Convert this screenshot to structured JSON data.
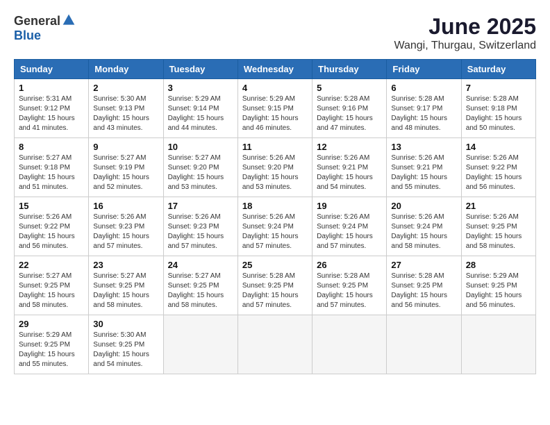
{
  "logo": {
    "general": "General",
    "blue": "Blue"
  },
  "title": {
    "month": "June 2025",
    "location": "Wangi, Thurgau, Switzerland"
  },
  "calendar": {
    "headers": [
      "Sunday",
      "Monday",
      "Tuesday",
      "Wednesday",
      "Thursday",
      "Friday",
      "Saturday"
    ],
    "weeks": [
      [
        {
          "day": "1",
          "sunrise": "5:31 AM",
          "sunset": "9:12 PM",
          "daylight": "15 hours and 41 minutes."
        },
        {
          "day": "2",
          "sunrise": "5:30 AM",
          "sunset": "9:13 PM",
          "daylight": "15 hours and 43 minutes."
        },
        {
          "day": "3",
          "sunrise": "5:29 AM",
          "sunset": "9:14 PM",
          "daylight": "15 hours and 44 minutes."
        },
        {
          "day": "4",
          "sunrise": "5:29 AM",
          "sunset": "9:15 PM",
          "daylight": "15 hours and 46 minutes."
        },
        {
          "day": "5",
          "sunrise": "5:28 AM",
          "sunset": "9:16 PM",
          "daylight": "15 hours and 47 minutes."
        },
        {
          "day": "6",
          "sunrise": "5:28 AM",
          "sunset": "9:17 PM",
          "daylight": "15 hours and 48 minutes."
        },
        {
          "day": "7",
          "sunrise": "5:28 AM",
          "sunset": "9:18 PM",
          "daylight": "15 hours and 50 minutes."
        }
      ],
      [
        {
          "day": "8",
          "sunrise": "5:27 AM",
          "sunset": "9:18 PM",
          "daylight": "15 hours and 51 minutes."
        },
        {
          "day": "9",
          "sunrise": "5:27 AM",
          "sunset": "9:19 PM",
          "daylight": "15 hours and 52 minutes."
        },
        {
          "day": "10",
          "sunrise": "5:27 AM",
          "sunset": "9:20 PM",
          "daylight": "15 hours and 53 minutes."
        },
        {
          "day": "11",
          "sunrise": "5:26 AM",
          "sunset": "9:20 PM",
          "daylight": "15 hours and 53 minutes."
        },
        {
          "day": "12",
          "sunrise": "5:26 AM",
          "sunset": "9:21 PM",
          "daylight": "15 hours and 54 minutes."
        },
        {
          "day": "13",
          "sunrise": "5:26 AM",
          "sunset": "9:21 PM",
          "daylight": "15 hours and 55 minutes."
        },
        {
          "day": "14",
          "sunrise": "5:26 AM",
          "sunset": "9:22 PM",
          "daylight": "15 hours and 56 minutes."
        }
      ],
      [
        {
          "day": "15",
          "sunrise": "5:26 AM",
          "sunset": "9:22 PM",
          "daylight": "15 hours and 56 minutes."
        },
        {
          "day": "16",
          "sunrise": "5:26 AM",
          "sunset": "9:23 PM",
          "daylight": "15 hours and 57 minutes."
        },
        {
          "day": "17",
          "sunrise": "5:26 AM",
          "sunset": "9:23 PM",
          "daylight": "15 hours and 57 minutes."
        },
        {
          "day": "18",
          "sunrise": "5:26 AM",
          "sunset": "9:24 PM",
          "daylight": "15 hours and 57 minutes."
        },
        {
          "day": "19",
          "sunrise": "5:26 AM",
          "sunset": "9:24 PM",
          "daylight": "15 hours and 57 minutes."
        },
        {
          "day": "20",
          "sunrise": "5:26 AM",
          "sunset": "9:24 PM",
          "daylight": "15 hours and 58 minutes."
        },
        {
          "day": "21",
          "sunrise": "5:26 AM",
          "sunset": "9:25 PM",
          "daylight": "15 hours and 58 minutes."
        }
      ],
      [
        {
          "day": "22",
          "sunrise": "5:27 AM",
          "sunset": "9:25 PM",
          "daylight": "15 hours and 58 minutes."
        },
        {
          "day": "23",
          "sunrise": "5:27 AM",
          "sunset": "9:25 PM",
          "daylight": "15 hours and 58 minutes."
        },
        {
          "day": "24",
          "sunrise": "5:27 AM",
          "sunset": "9:25 PM",
          "daylight": "15 hours and 58 minutes."
        },
        {
          "day": "25",
          "sunrise": "5:28 AM",
          "sunset": "9:25 PM",
          "daylight": "15 hours and 57 minutes."
        },
        {
          "day": "26",
          "sunrise": "5:28 AM",
          "sunset": "9:25 PM",
          "daylight": "15 hours and 57 minutes."
        },
        {
          "day": "27",
          "sunrise": "5:28 AM",
          "sunset": "9:25 PM",
          "daylight": "15 hours and 56 minutes."
        },
        {
          "day": "28",
          "sunrise": "5:29 AM",
          "sunset": "9:25 PM",
          "daylight": "15 hours and 56 minutes."
        }
      ],
      [
        {
          "day": "29",
          "sunrise": "5:29 AM",
          "sunset": "9:25 PM",
          "daylight": "15 hours and 55 minutes."
        },
        {
          "day": "30",
          "sunrise": "5:30 AM",
          "sunset": "9:25 PM",
          "daylight": "15 hours and 54 minutes."
        },
        null,
        null,
        null,
        null,
        null
      ]
    ]
  }
}
